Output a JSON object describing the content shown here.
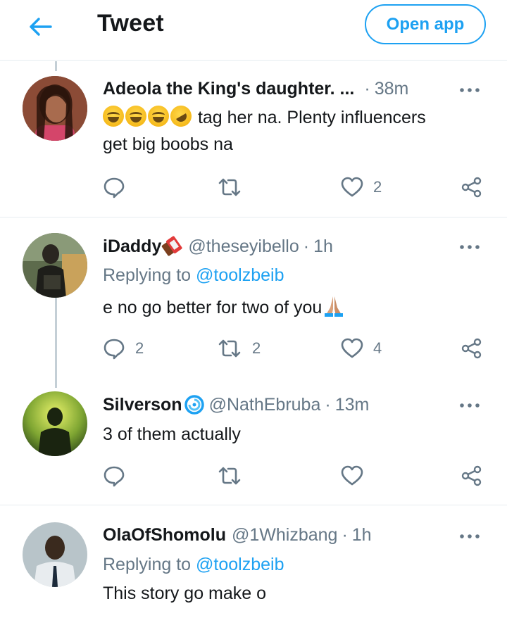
{
  "header": {
    "title": "Tweet",
    "open_app_label": "Open app"
  },
  "colors": {
    "accent": "#1da1f2",
    "muted": "#657786",
    "text": "#14171a",
    "divider": "#e6ecf0"
  },
  "tweets": [
    {
      "name": "Adeola the King's daughter. ...",
      "handle": "",
      "time": "38m",
      "replying_to": "",
      "text_line1": "tag her na. Plenty influencers",
      "text_line2": "get big boobs na",
      "emojis": [
        "face-with-tears-of-joy",
        "face-with-tears-of-joy",
        "face-with-tears-of-joy",
        "rolling-on-floor-laughing"
      ],
      "reply_count": "",
      "retweet_count": "",
      "like_count": "2"
    },
    {
      "name": "iDaddy",
      "name_emoji": "chocolate-bar",
      "handle": "@theseyibello",
      "time": "1h",
      "replying_to_prefix": "Replying to",
      "replying_to": "@toolzbeib",
      "text_line1": "e no go better for two of you",
      "text_emoji": "folded-hands",
      "reply_count": "2",
      "retweet_count": "2",
      "like_count": "4"
    },
    {
      "name": "Silverson",
      "name_emoji": "cyclone",
      "handle": "@NathEbruba",
      "time": "13m",
      "text_line1": "3 of them actually",
      "reply_count": "",
      "retweet_count": "",
      "like_count": ""
    },
    {
      "name": "OlaOfShomolu",
      "handle": "@1Whizbang",
      "time": "1h",
      "replying_to_prefix": "Replying to",
      "replying_to": "@toolzbeib",
      "text_line1": "This story go make o"
    }
  ],
  "icons": {
    "back": "arrow-left-icon",
    "more": "more-dots-icon",
    "reply": "reply-bubble-icon",
    "retweet": "retweet-icon",
    "like": "heart-icon",
    "share": "share-icon"
  }
}
